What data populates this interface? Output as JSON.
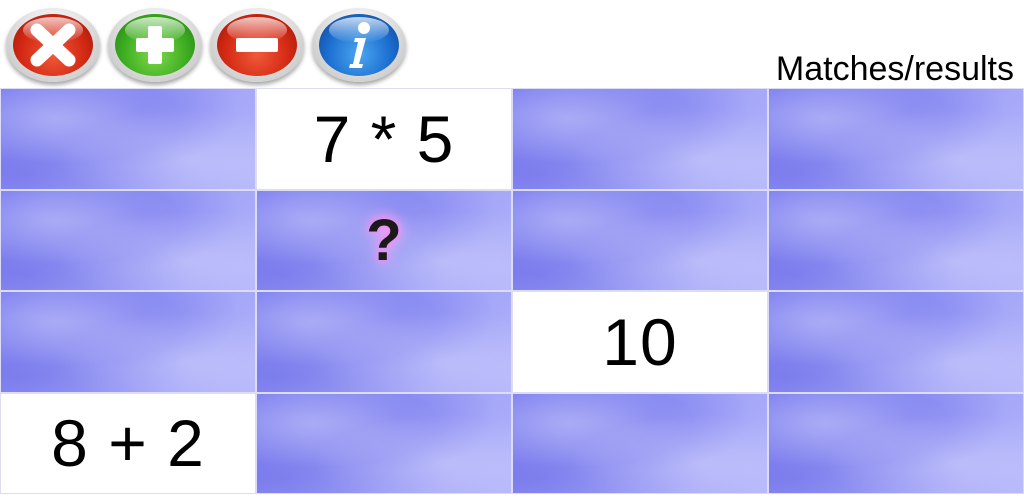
{
  "toolbar": {
    "buttons": [
      {
        "name": "close",
        "icon": "close-icon",
        "color": "#d42a14"
      },
      {
        "name": "add",
        "icon": "plus-icon",
        "color": "#3fae22"
      },
      {
        "name": "remove",
        "icon": "minus-icon",
        "color": "#d42a14"
      },
      {
        "name": "info",
        "icon": "info-icon",
        "color": "#1c6fd0"
      }
    ]
  },
  "header": {
    "title": "Matches/results"
  },
  "board": {
    "hidden_color": "#9a9cf6",
    "cells": [
      {
        "state": "hidden",
        "text": ""
      },
      {
        "state": "revealed",
        "text": "7 * 5"
      },
      {
        "state": "hidden",
        "text": ""
      },
      {
        "state": "hidden",
        "text": ""
      },
      {
        "state": "hidden",
        "text": ""
      },
      {
        "state": "hint",
        "text": "?"
      },
      {
        "state": "hidden",
        "text": ""
      },
      {
        "state": "hidden",
        "text": ""
      },
      {
        "state": "hidden",
        "text": ""
      },
      {
        "state": "hidden",
        "text": ""
      },
      {
        "state": "revealed",
        "text": "10"
      },
      {
        "state": "hidden",
        "text": ""
      },
      {
        "state": "revealed",
        "text": "8 + 2"
      },
      {
        "state": "hidden",
        "text": ""
      },
      {
        "state": "hidden",
        "text": ""
      },
      {
        "state": "hidden",
        "text": ""
      }
    ]
  }
}
